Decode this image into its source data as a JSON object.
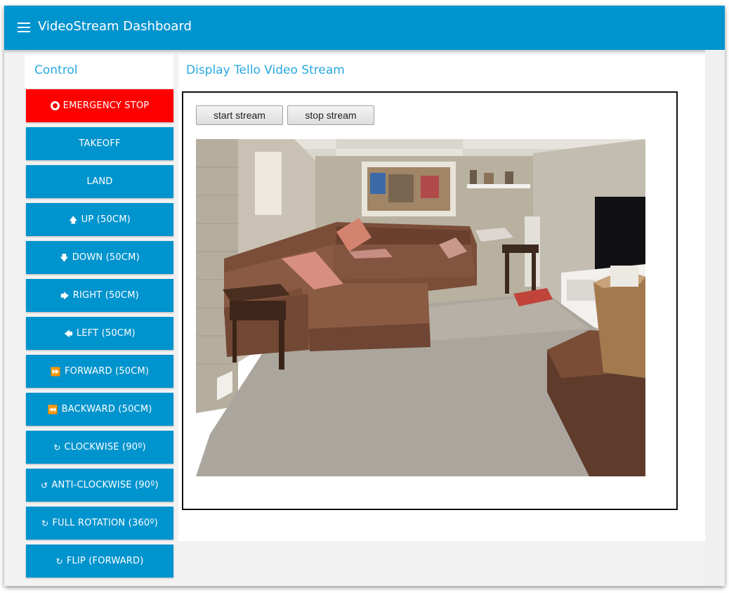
{
  "app": {
    "title": "VideoStream Dashboard"
  },
  "control": {
    "header": "Control",
    "buttons": [
      {
        "label": "EMERGENCY STOP",
        "icon": "stop-circle-icon",
        "danger": true
      },
      {
        "label": "TAKEOFF",
        "icon": ""
      },
      {
        "label": "LAND",
        "icon": ""
      },
      {
        "label": "UP (50CM)",
        "icon": "arrow-up-icon"
      },
      {
        "label": "DOWN (50CM)",
        "icon": "arrow-down-icon"
      },
      {
        "label": "RIGHT (50CM)",
        "icon": "arrow-right-icon"
      },
      {
        "label": "LEFT (50CM)",
        "icon": "arrow-left-icon"
      },
      {
        "label": "FORWARD (50CM)",
        "icon": "fast-forward-icon"
      },
      {
        "label": "BACKWARD (50CM)",
        "icon": "fast-backward-icon"
      },
      {
        "label": "CLOCKWISE (90º)",
        "icon": "rotate-right-icon"
      },
      {
        "label": "ANTI-CLOCKWISE (90º)",
        "icon": "rotate-left-icon"
      },
      {
        "label": "FULL ROTATION (360º)",
        "icon": "rotate-right-icon"
      },
      {
        "label": "FLIP (FORWARD)",
        "icon": "rotate-right-icon"
      }
    ]
  },
  "stream": {
    "header": "Display Tello Video Stream",
    "start_label": "start stream",
    "stop_label": "stop stream"
  },
  "colors": {
    "accent": "#0094ce",
    "danger": "#ff0000",
    "heading": "#28a8e0"
  }
}
